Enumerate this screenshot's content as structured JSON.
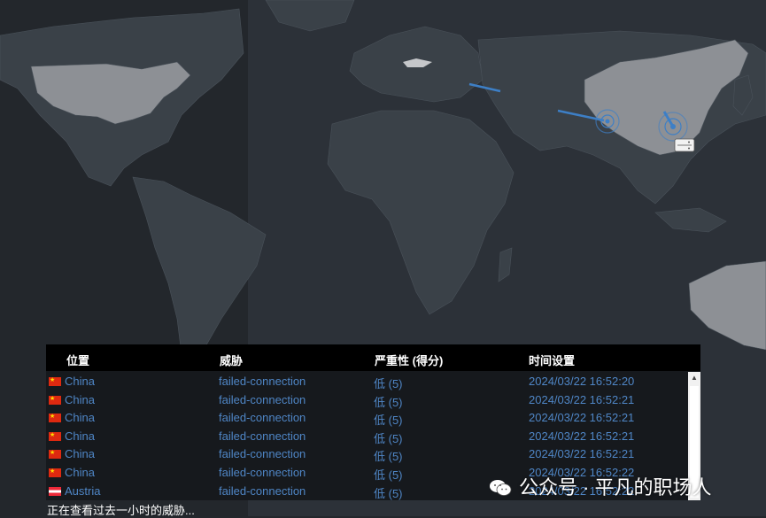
{
  "table": {
    "columns": [
      "位置",
      "威胁",
      "严重性 (得分)",
      "时间设置"
    ],
    "rows": [
      {
        "flag": "cn",
        "location": "China",
        "threat": "failed-connection",
        "severity": "低 (5)",
        "time": "2024/03/22 16:52:20"
      },
      {
        "flag": "cn",
        "location": "China",
        "threat": "failed-connection",
        "severity": "低 (5)",
        "time": "2024/03/22 16:52:21"
      },
      {
        "flag": "cn",
        "location": "China",
        "threat": "failed-connection",
        "severity": "低 (5)",
        "time": "2024/03/22 16:52:21"
      },
      {
        "flag": "cn",
        "location": "China",
        "threat": "failed-connection",
        "severity": "低 (5)",
        "time": "2024/03/22 16:52:21"
      },
      {
        "flag": "cn",
        "location": "China",
        "threat": "failed-connection",
        "severity": "低 (5)",
        "time": "2024/03/22 16:52:21"
      },
      {
        "flag": "cn",
        "location": "China",
        "threat": "failed-connection",
        "severity": "低 (5)",
        "time": "2024/03/22 16:52:22"
      },
      {
        "flag": "at",
        "location": "Austria",
        "threat": "failed-connection",
        "severity": "低 (5)",
        "time": "2024/03/22 16:52:22"
      }
    ]
  },
  "status_text": "正在查看过去一小时的威胁...",
  "watermark": "公众号 · 平凡的职场人",
  "colors": {
    "background": "#23272c",
    "land": "#3a4148",
    "land_highlight": "#8d9095",
    "attack_line": "#3d7fc6",
    "link_text": "#4f86c6"
  }
}
